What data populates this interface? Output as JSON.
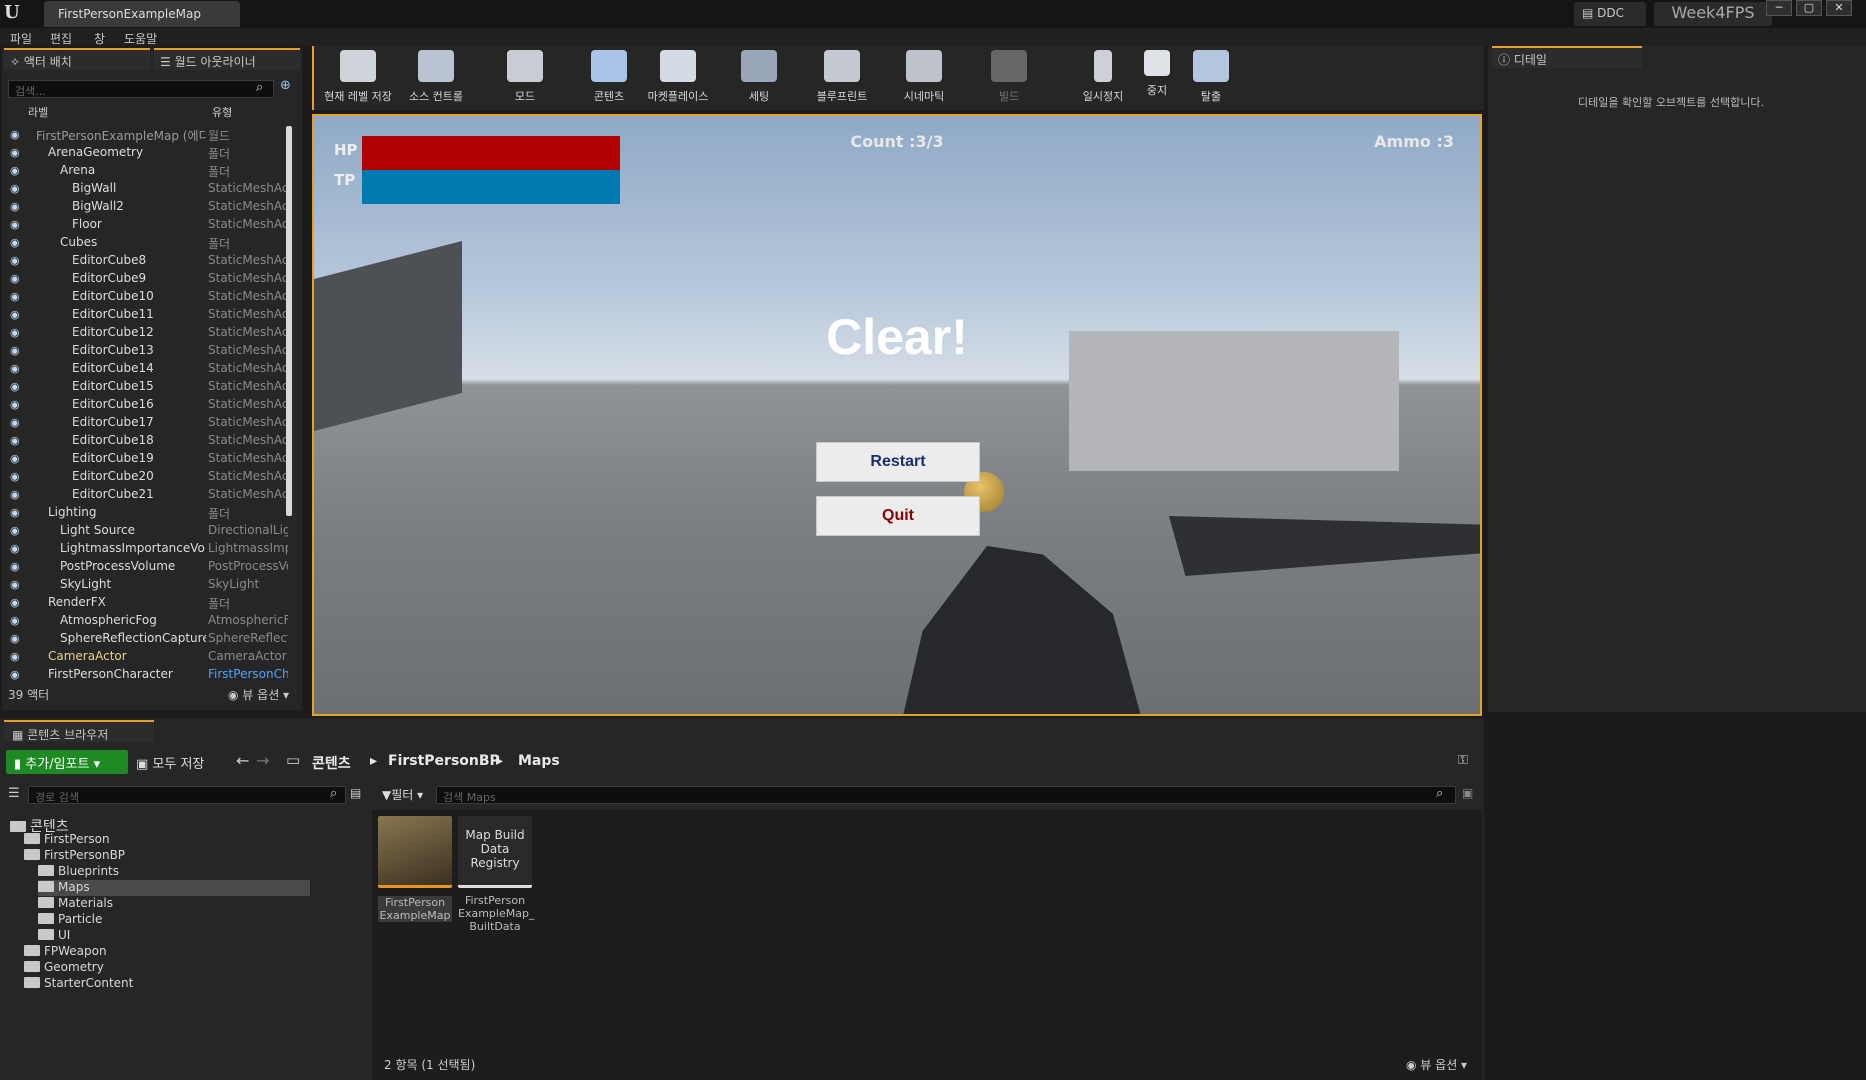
{
  "app": {
    "doc_tab": "FirstPersonExampleMap",
    "ddc": "DDC",
    "project": "Week4FPS",
    "window_min": "─",
    "window_max": "▢",
    "window_close": "✕"
  },
  "menu": [
    "파일",
    "편집",
    "창",
    "도움말"
  ],
  "outliner": {
    "tab_actor": "액터 배치",
    "tab_world": "월드 아웃라이너",
    "search_placeholder": "검색...",
    "col_label": "라벨",
    "col_type": "유형",
    "rows": [
      {
        "name": "FirstPersonExampleMap (에디터)",
        "type": "월드"
      },
      {
        "name": "ArenaGeometry",
        "type": "폴더"
      },
      {
        "name": "Arena",
        "type": "폴더"
      },
      {
        "name": "BigWall",
        "type": "StaticMeshActor"
      },
      {
        "name": "BigWall2",
        "type": "StaticMeshActor"
      },
      {
        "name": "Floor",
        "type": "StaticMeshActor"
      },
      {
        "name": "Cubes",
        "type": "폴더"
      },
      {
        "name": "EditorCube8",
        "type": "StaticMeshActor"
      },
      {
        "name": "EditorCube9",
        "type": "StaticMeshActor"
      },
      {
        "name": "EditorCube10",
        "type": "StaticMeshActor"
      },
      {
        "name": "EditorCube11",
        "type": "StaticMeshActor"
      },
      {
        "name": "EditorCube12",
        "type": "StaticMeshActor"
      },
      {
        "name": "EditorCube13",
        "type": "StaticMeshActor"
      },
      {
        "name": "EditorCube14",
        "type": "StaticMeshActor"
      },
      {
        "name": "EditorCube15",
        "type": "StaticMeshActor"
      },
      {
        "name": "EditorCube16",
        "type": "StaticMeshActor"
      },
      {
        "name": "EditorCube17",
        "type": "StaticMeshActor"
      },
      {
        "name": "EditorCube18",
        "type": "StaticMeshActor"
      },
      {
        "name": "EditorCube19",
        "type": "StaticMeshActor"
      },
      {
        "name": "EditorCube20",
        "type": "StaticMeshActor"
      },
      {
        "name": "EditorCube21",
        "type": "StaticMeshActor"
      },
      {
        "name": "Lighting",
        "type": "폴더"
      },
      {
        "name": "Light Source",
        "type": "DirectionalLight"
      },
      {
        "name": "LightmassImportanceVolume",
        "type": "LightmassImportanceVolume"
      },
      {
        "name": "PostProcessVolume",
        "type": "PostProcessVolume"
      },
      {
        "name": "SkyLight",
        "type": "SkyLight"
      },
      {
        "name": "RenderFX",
        "type": "폴더"
      },
      {
        "name": "AtmosphericFog",
        "type": "AtmosphericFog"
      },
      {
        "name": "SphereReflectionCapture",
        "type": "SphereReflectionCapture"
      },
      {
        "name": "CameraActor",
        "type": "CameraActor"
      },
      {
        "name": "FirstPersonCharacter",
        "type": "FirstPersonCharacter"
      }
    ],
    "actor_count": "39 액터",
    "view_options": "뷰 옵션"
  },
  "toolbar": [
    "현재 레벨 저장",
    "소스 컨트롤",
    "모드",
    "콘텐츠",
    "마켓플레이스",
    "세팅",
    "블루프린트",
    "시네마틱",
    "빌드",
    "일시정지",
    "중지",
    "탈출"
  ],
  "game": {
    "hp_label": "HP",
    "tp_label": "TP",
    "hp_fraction": 1.0,
    "tp_fraction": 1.0,
    "count": "Count :3/3",
    "ammo": "Ammo :3",
    "clear": "Clear!",
    "restart": "Restart",
    "quit": "Quit",
    "hp_color": "#b00000",
    "tp_color": "#007ab0",
    "restart_color": "#1a2f6e",
    "quit_color": "#8b0000"
  },
  "details": {
    "tab": "디테일",
    "message": "디테일을 확인할 오브젝트를 선택합니다."
  },
  "content_browser": {
    "tab": "콘텐츠 브라우저",
    "add_import": "추가/임포트",
    "save_all": "모두 저장",
    "crumbs": [
      "콘텐츠",
      "FirstPersonBP",
      "Maps"
    ],
    "path_search_placeholder": "경로 검색",
    "filter": "필터",
    "asset_search_placeholder": "검색 Maps",
    "folders": [
      {
        "name": "콘텐츠",
        "level": 0
      },
      {
        "name": "FirstPerson",
        "level": 1
      },
      {
        "name": "FirstPersonBP",
        "level": 1
      },
      {
        "name": "Blueprints",
        "level": 2
      },
      {
        "name": "Maps",
        "level": 2
      },
      {
        "name": "Materials",
        "level": 2
      },
      {
        "name": "Particle",
        "level": 2
      },
      {
        "name": "UI",
        "level": 2
      },
      {
        "name": "FPWeapon",
        "level": 1
      },
      {
        "name": "Geometry",
        "level": 1
      },
      {
        "name": "StarterContent",
        "level": 1
      }
    ],
    "assets": [
      {
        "thumb_text": "",
        "label": "FirstPerson ExampleMap"
      },
      {
        "thumb_text": "Map Build Data Registry",
        "label": "FirstPerson ExampleMap_ BuiltData"
      }
    ],
    "count": "2 항목 (1 선택됨)",
    "view_options": "뷰 옵션",
    "accent": "#1e8a24"
  }
}
